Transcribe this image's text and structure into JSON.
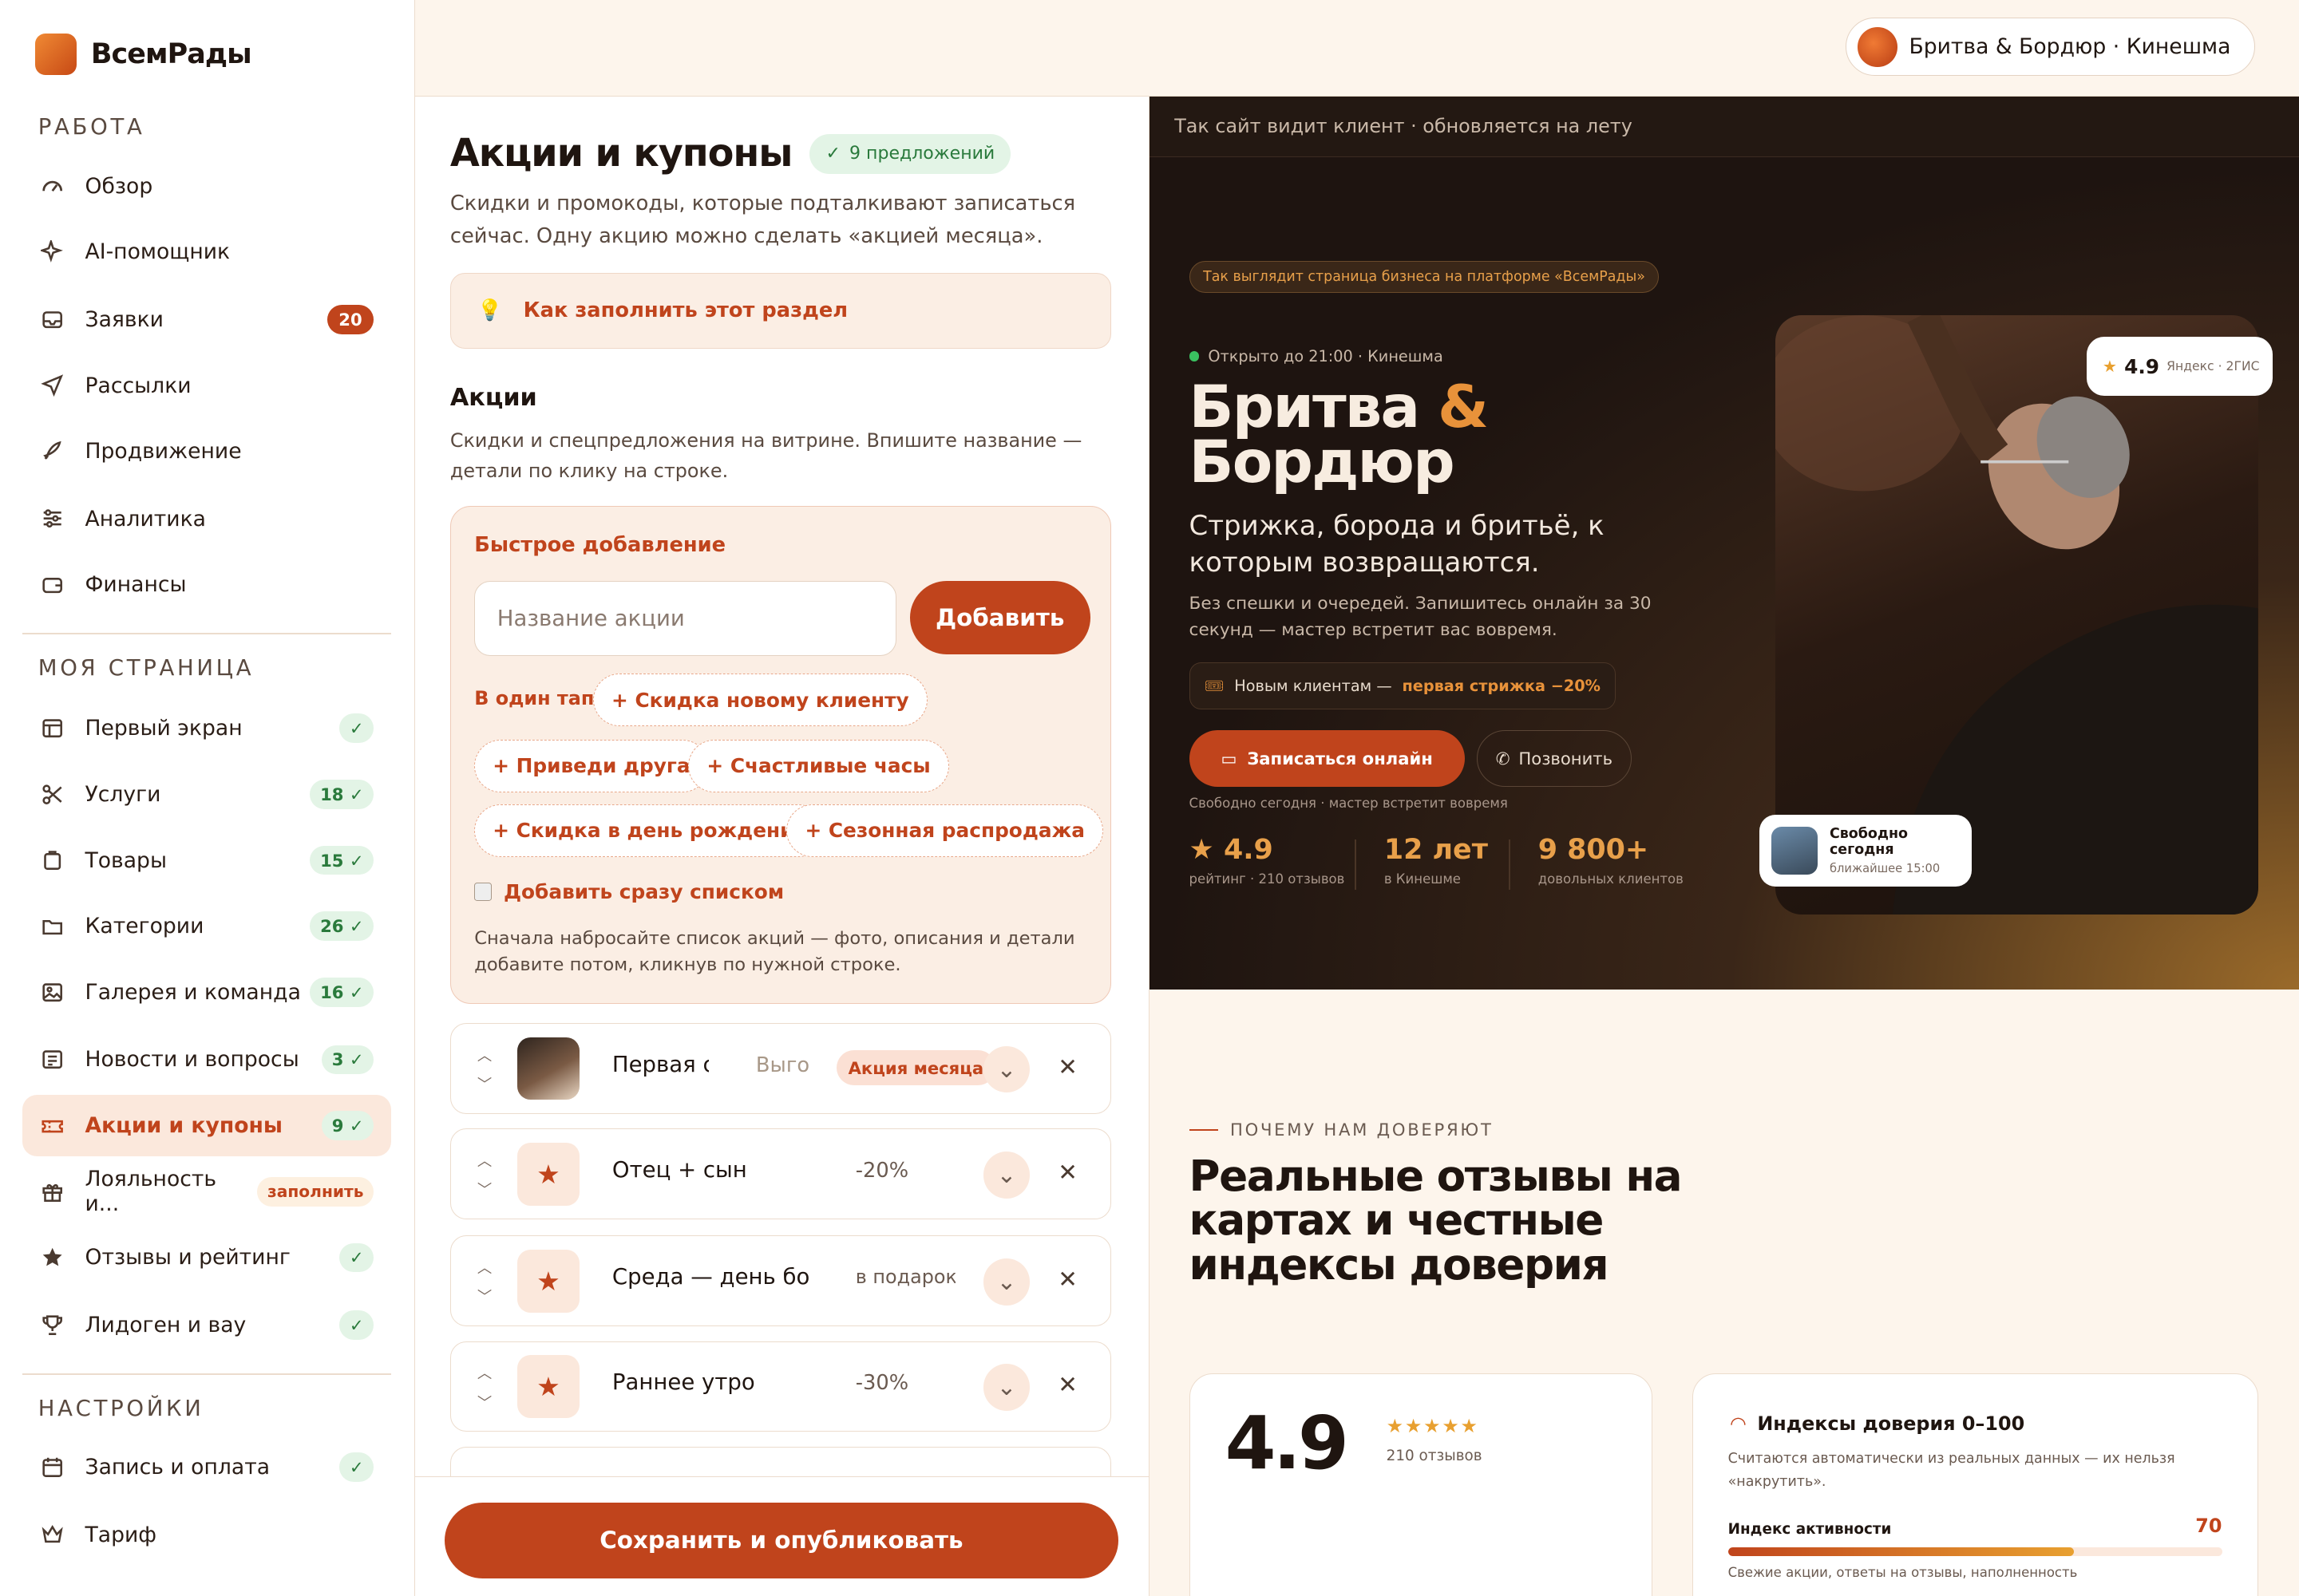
{
  "app": {
    "logo_text": "ВсемРады"
  },
  "sidebar": {
    "sections": {
      "work": "РАБОТА",
      "my_page": "МОЯ СТРАНИЦА",
      "settings": "НАСТРОЙКИ"
    },
    "items": [
      {
        "label": "Обзор",
        "icon": "gauge-icon"
      },
      {
        "label": "AI-помощник",
        "icon": "sparkle-icon"
      },
      {
        "label": "Заявки",
        "icon": "inbox-icon",
        "badge": "20"
      },
      {
        "label": "Рассылки",
        "icon": "send-icon"
      },
      {
        "label": "Продвижение",
        "icon": "rocket-icon"
      },
      {
        "label": "Аналитика",
        "icon": "sliders-icon"
      },
      {
        "label": "Финансы",
        "icon": "wallet-icon"
      },
      {
        "label": "Первый экран",
        "icon": "layout-icon",
        "badge": "✓"
      },
      {
        "label": "Услуги",
        "icon": "scissors-icon",
        "badge": "18 ✓"
      },
      {
        "label": "Товары",
        "icon": "bag-icon",
        "badge": "15 ✓"
      },
      {
        "label": "Категории",
        "icon": "folder-icon",
        "badge": "26 ✓"
      },
      {
        "label": "Галерея и команда",
        "icon": "image-icon",
        "badge": "16 ✓"
      },
      {
        "label": "Новости и вопросы",
        "icon": "news-icon",
        "badge": "3 ✓"
      },
      {
        "label": "Акции и купоны",
        "icon": "ticket-icon",
        "badge": "9 ✓"
      },
      {
        "label": "Лояльность и...",
        "icon": "gift-icon",
        "badge": "заполнить"
      },
      {
        "label": "Отзывы и рейтинг",
        "icon": "star-icon",
        "badge": "✓"
      },
      {
        "label": "Лидоген и вау",
        "icon": "trophy-icon",
        "badge": "✓"
      },
      {
        "label": "Запись и оплата",
        "icon": "calendar-icon",
        "badge": "✓"
      },
      {
        "label": "Тариф",
        "icon": "crown-icon"
      }
    ]
  },
  "topbar": {
    "business": "Бритва & Бордюр · Кинешма"
  },
  "editor": {
    "title": "Акции и купоны",
    "count_pill": "9 предложений",
    "subtitle": "Скидки и промокоды, которые подталкивают записаться сейчас. Одну акцию можно сделать «акцией месяца».",
    "hint": "Как заполнить этот раздел",
    "section_title": "Акции",
    "section_sub": "Скидки и спецпредложения на витрине. Впишите название — детали по клику на строке.",
    "quick": {
      "title": "Быстрое добавление",
      "placeholder": "Название акции",
      "add": "Добавить",
      "one_tap": "В один тап:",
      "chips": [
        "+ Скидка новому клиенту",
        "+ Приведи друга",
        "+ Счастливые часы",
        "+ Скидка в день рождения",
        "+ Сезонная распродажа"
      ],
      "list_link": "Добавить сразу списком",
      "note": "Сначала набросайте список акций — фото, описания и детали добавите потом, кликнув по нужной строке."
    },
    "rows": [
      {
        "name": "Первая стрижка",
        "value": "Выгода",
        "badge": "Акция месяца"
      },
      {
        "name": "Отец + сын",
        "value": "-20%"
      },
      {
        "name": "Среда — день бороды",
        "value": "в подарок"
      },
      {
        "name": "Раннее утро",
        "value": "-30%"
      }
    ],
    "save": "Сохранить и опубликовать"
  },
  "preview": {
    "header": "Так сайт видит клиент · обновляется на лету",
    "platform_tag": "Так выглядит страница бизнеса на платформе «ВсемРады»",
    "open": "Открыто до 21:00 · Кинешма",
    "name_line1": "Бритва",
    "name_amp": "&",
    "name_line2": "Бордюр",
    "tagline": "Стрижка, борода и бритьё, к которым возвращаются.",
    "desc": "Без спешки и очередей. Запишитесь онлайн за 30 секунд — мастер встретит вас вовремя.",
    "promo_prefix": "Новым клиентам —",
    "promo_bold": "первая стрижка −20%",
    "book": "Записаться онлайн",
    "call": "Позвонить",
    "free": "Свободно сегодня · мастер встретит вовремя",
    "stats": [
      {
        "value": "★ 4.9",
        "label": "рейтинг · 210 отзывов"
      },
      {
        "value": "12 лет",
        "label": "в Кинешме"
      },
      {
        "value": "9 800+",
        "label": "довольных клиентов"
      }
    ],
    "rating_value": "4.9",
    "rating_src": "Яндекс · 2ГИС",
    "free_card_title": "Свободно сегодня",
    "free_card_sub": "ближайшее 15:00",
    "why": "ПОЧЕМУ НАМ ДОВЕРЯЮТ",
    "reviews_title": "Реальные отзывы на картах и честные индексы доверия",
    "big_rating": "4.9",
    "stars": "★★★★★",
    "reviews_count": "210 отзывов",
    "trust_title": "Индексы доверия 0–100",
    "trust_desc": "Считаются автоматически из реальных данных — их нельзя «накрутить».",
    "activity_label": "Индекс активности",
    "activity_value": "70",
    "activity_progress": 0.7,
    "activity_sub": "Свежие акции, ответы на отзывы, наполненность"
  },
  "colors": {
    "accent": "#c0441c",
    "gold": "#e8a030",
    "dark": "#1e1410"
  }
}
